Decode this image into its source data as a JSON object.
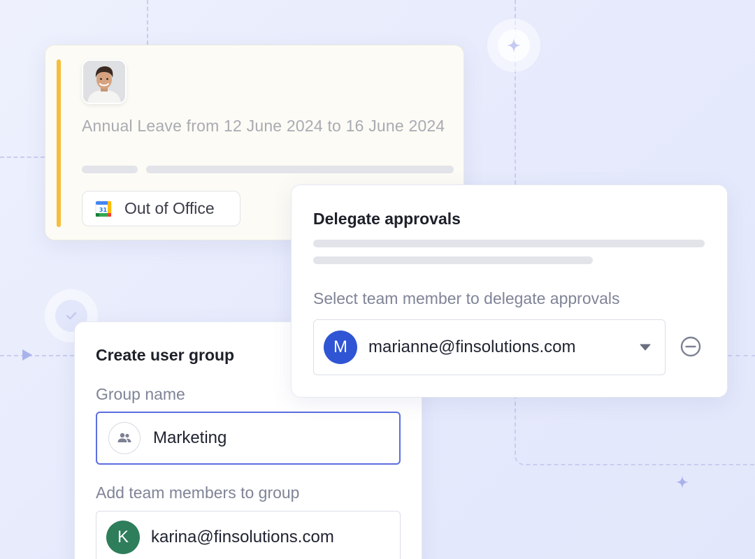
{
  "leave_card": {
    "description": "Annual Leave from 12 June 2024 to 16 June 2024",
    "status_pill": {
      "label": "Out of Office",
      "calendar_day": "31",
      "icon": "google-calendar-icon"
    },
    "accent_color": "#f6be3b"
  },
  "delegate_card": {
    "title": "Delegate approvals",
    "select_label": "Select team member to delegate approvals",
    "selected_member": {
      "avatar_letter": "M",
      "avatar_color": "#2f55d4",
      "email": "marianne@finsolutions.com"
    },
    "dropdown_icon": "caret-down-icon",
    "remove_icon": "minus-circle-icon"
  },
  "group_card": {
    "title": "Create user group",
    "group_name_label": "Group name",
    "group_name_value": "Marketing",
    "group_icon": "users-icon",
    "members_label": "Add team members to group",
    "member": {
      "avatar_letter": "K",
      "avatar_color": "#2e7d5b",
      "email": "karina@finsolutions.com"
    }
  },
  "decorations": {
    "sparkle_icon": "sparkle-icon",
    "check_icon": "check-icon"
  }
}
